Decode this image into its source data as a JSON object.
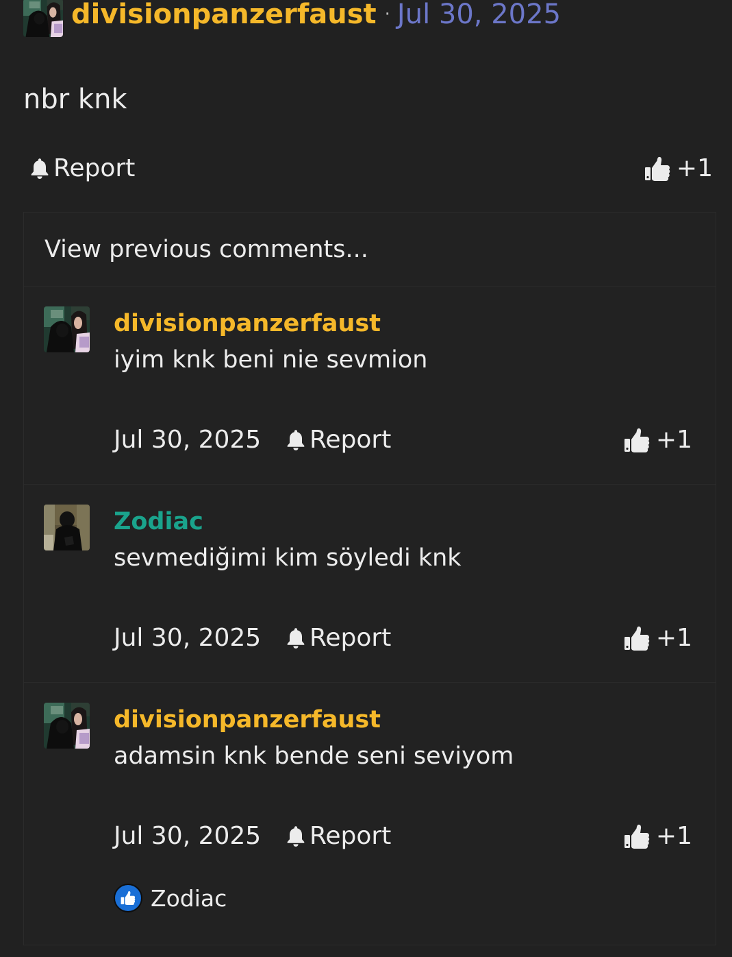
{
  "post": {
    "author": "divisionpanzerfaust",
    "author_color": "#f5b82a",
    "separator": "·",
    "date": "Jul 30, 2025",
    "date_color": "#6c77c9",
    "body": "nbr knk",
    "report_label": "Report",
    "report_icon": "bell-icon",
    "vote_icon": "thumbs-up-icon",
    "vote_count": "+1"
  },
  "comments": {
    "view_previous": "View previous comments...",
    "items": [
      {
        "author": "divisionpanzerfaust",
        "author_color": "#f5b82a",
        "text": "iyim knk beni nie sevmion",
        "date": "Jul 30, 2025",
        "report_label": "Report",
        "vote_count": "+1"
      },
      {
        "author": "Zodiac",
        "author_color": "#1aa38c",
        "text": "sevmediğimi kim söyledi knk",
        "date": "Jul 30, 2025",
        "report_label": "Report",
        "vote_count": "+1"
      },
      {
        "author": "divisionpanzerfaust",
        "author_color": "#f5b82a",
        "text": "adamsin knk bende seni seviyom",
        "date": "Jul 30, 2025",
        "report_label": "Report",
        "vote_count": "+1",
        "reaction": {
          "icon": "thumbs-up-badge-icon",
          "user": "Zodiac"
        }
      }
    ]
  }
}
